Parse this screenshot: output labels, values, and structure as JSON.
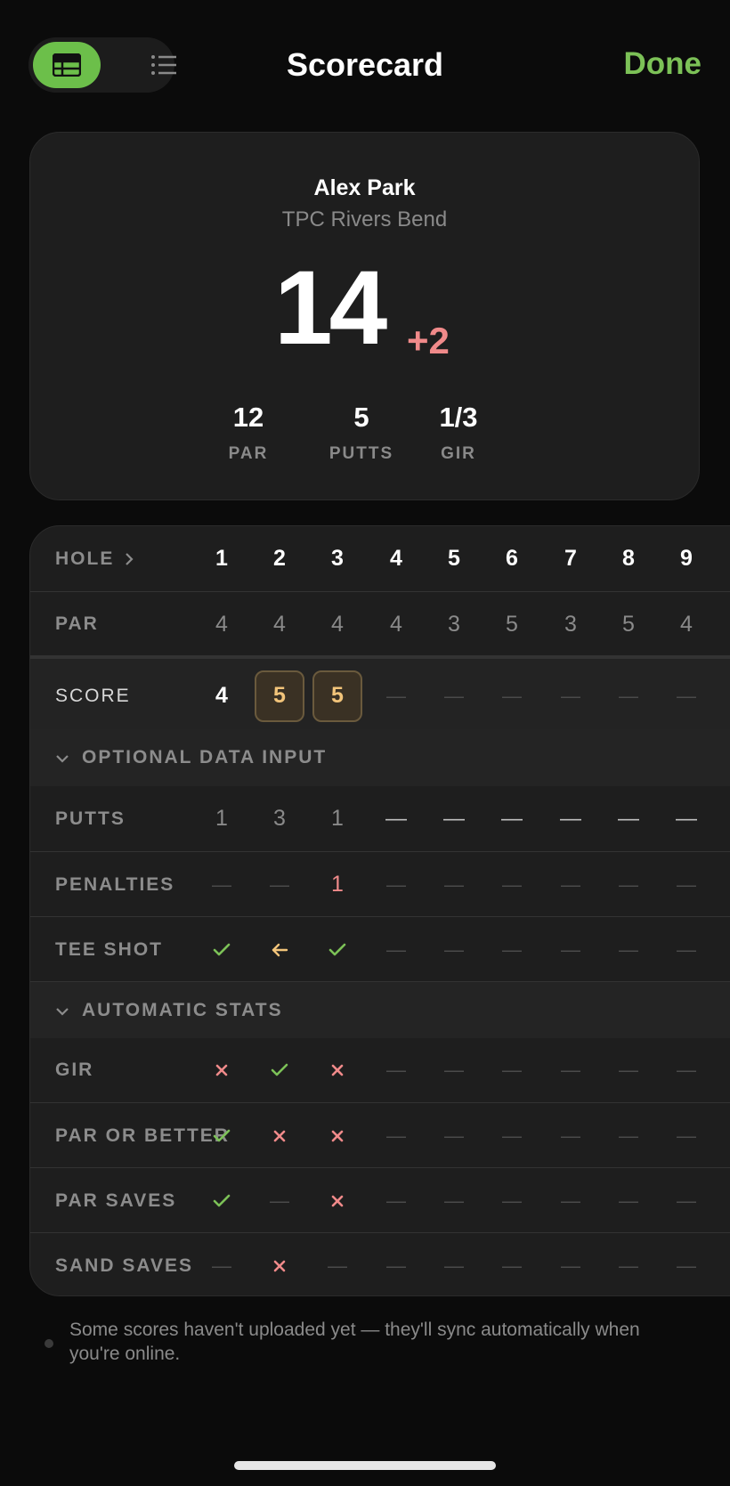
{
  "header": {
    "title": "Scorecard",
    "done_label": "Done",
    "view_toggle": {
      "active": "grid-icon",
      "inactive": "list-icon"
    }
  },
  "summary": {
    "player": "Alex Park",
    "course": "TPC Rivers Bend",
    "total": "14",
    "to_par": "+2",
    "stats": [
      {
        "value": "12",
        "label": "PAR"
      },
      {
        "value": "5",
        "label": "PUTTS"
      },
      {
        "value": "1/3",
        "label": "GIR"
      }
    ]
  },
  "table": {
    "hole_label": "HOLE",
    "holes": [
      "1",
      "2",
      "3",
      "4",
      "5",
      "6",
      "7",
      "8",
      "9"
    ],
    "par_label": "PAR",
    "pars": [
      "4",
      "4",
      "4",
      "4",
      "3",
      "5",
      "3",
      "5",
      "4"
    ],
    "score_label": "SCORE",
    "scores": [
      "4",
      "5",
      "5",
      "—",
      "—",
      "—",
      "—",
      "—",
      "—"
    ],
    "optional_section": "OPTIONAL DATA INPUT",
    "putts_label": "PUTTS",
    "putts": [
      "1",
      "3",
      "1",
      "—",
      "—",
      "—",
      "—",
      "—",
      "—"
    ],
    "penalties_label": "PENALTIES",
    "penalties": [
      "—",
      "—",
      "1",
      "—",
      "—",
      "—",
      "—",
      "—",
      "—"
    ],
    "tee_shot_label": "TEE SHOT",
    "tee_shot": [
      "check",
      "left",
      "check",
      "—",
      "—",
      "—",
      "—",
      "—",
      "—"
    ],
    "auto_section": "AUTOMATIC STATS",
    "gir_label": "GIR",
    "gir": [
      "x",
      "check",
      "x",
      "—",
      "—",
      "—",
      "—",
      "—",
      "—"
    ],
    "par_or_better_label": "PAR OR BETTER",
    "par_or_better": [
      "check",
      "x",
      "x",
      "—",
      "—",
      "—",
      "—",
      "—",
      "—"
    ],
    "par_saves_label": "PAR SAVES",
    "par_saves": [
      "check",
      "—",
      "x",
      "—",
      "—",
      "—",
      "—",
      "—",
      "—"
    ],
    "sand_saves_label": "SAND SAVES",
    "sand_saves": [
      "—",
      "x",
      "—",
      "—",
      "—",
      "—",
      "—",
      "—",
      "—"
    ]
  },
  "footer": {
    "sync_message": "Some scores haven't uploaded yet — they'll sync automatically when you're online."
  },
  "colors": {
    "accent": "#6cbf4a",
    "done": "#7cc157",
    "over_par": "#f08a8a",
    "check": "#7cc157",
    "cross": "#f08a8a",
    "left_arrow": "#f2c47a"
  }
}
